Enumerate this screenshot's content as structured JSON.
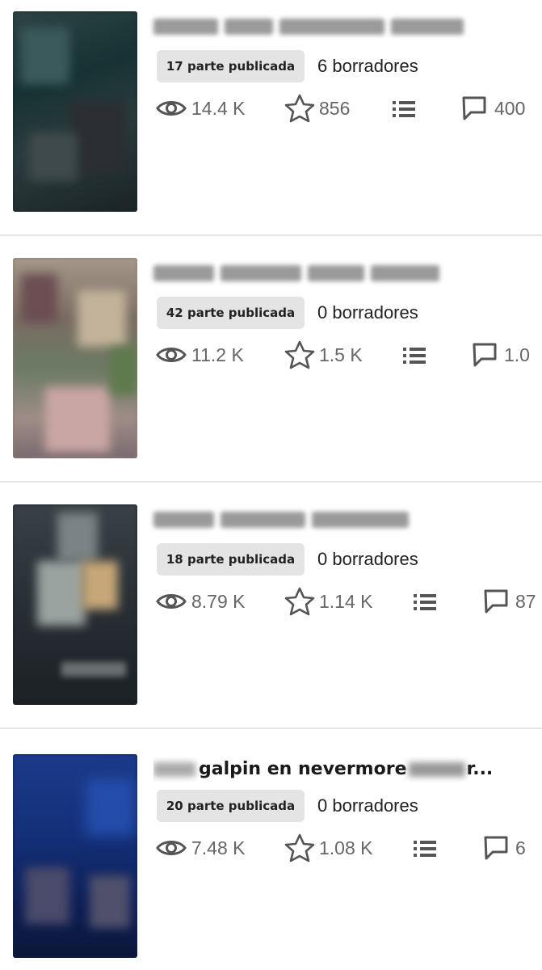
{
  "stories": [
    {
      "title": "",
      "parts_badge": "17 parte publicada",
      "drafts": "6 borradores",
      "views": "14.4 K",
      "votes": "856",
      "comments": "400"
    },
    {
      "title": "",
      "parts_badge": "42 parte publicada",
      "drafts": "0 borradores",
      "views": "11.2 K",
      "votes": "1.5 K",
      "comments": "1.0"
    },
    {
      "title": "",
      "parts_badge": "18 parte publicada",
      "drafts": "0 borradores",
      "views": "8.79 K",
      "votes": "1.14 K",
      "comments": "87"
    },
    {
      "title": "galpin en nevermore",
      "title_suffix": "r...",
      "parts_badge": "20 parte publicada",
      "drafts": "0 borradores",
      "views": "7.48 K",
      "votes": "1.08 K",
      "comments": "6"
    }
  ],
  "icons": {
    "views": "eye-icon",
    "votes": "star-icon",
    "parts": "list-icon",
    "comments": "comment-icon"
  },
  "colors": {
    "badge_bg": "#e4e4e4",
    "stat_text": "#666666",
    "icon": "#555555"
  }
}
